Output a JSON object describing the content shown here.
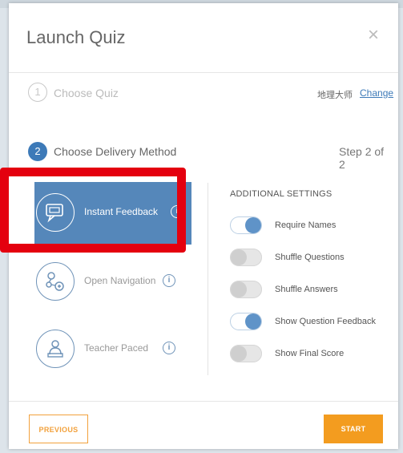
{
  "modal": {
    "title": "Launch Quiz",
    "close_glyph": "×"
  },
  "step1": {
    "number": "1",
    "label": "Choose Quiz",
    "quiz_name": "地理大师",
    "change_link": "Change"
  },
  "step2": {
    "number": "2",
    "label": "Choose Delivery Method",
    "step_count": "Step 2 of 2"
  },
  "methods": [
    {
      "label": "Instant Feedback",
      "icon": "speech-bubble-icon",
      "selected": true
    },
    {
      "label": "Open Navigation",
      "icon": "flowchart-icon",
      "selected": false
    },
    {
      "label": "Teacher Paced",
      "icon": "teacher-icon",
      "selected": false
    }
  ],
  "info_glyph": "i",
  "additional_settings": {
    "title": "ADDITIONAL SETTINGS",
    "items": [
      {
        "label": "Require Names",
        "on": true
      },
      {
        "label": "Shuffle Questions",
        "on": false
      },
      {
        "label": "Shuffle Answers",
        "on": false
      },
      {
        "label": "Show Question Feedback",
        "on": true
      },
      {
        "label": "Show Final Score",
        "on": false
      }
    ]
  },
  "footer": {
    "previous_label": "PREVIOUS",
    "start_label": "START"
  },
  "colors": {
    "accent_blue": "#5587ba",
    "highlight_red": "#e4000f",
    "orange": "#f39c1f"
  }
}
